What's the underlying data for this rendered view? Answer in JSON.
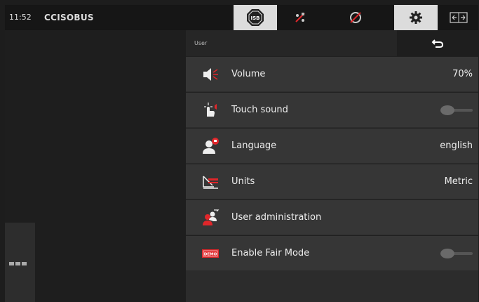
{
  "status": {
    "time": "11:52",
    "brand": "CCISOBUS"
  },
  "topbar": {
    "isb_label": "ISB",
    "buttons": [
      "isb-icon",
      "task-controller-icon",
      "speed-off-icon",
      "gear-icon",
      "switch-screen-icon"
    ]
  },
  "header": {
    "title": "User"
  },
  "settings": [
    {
      "label": "Volume",
      "value": "70%",
      "icon": "volume-icon"
    },
    {
      "label": "Touch sound",
      "value": "",
      "icon": "touch-sound-icon",
      "toggle": false
    },
    {
      "label": "Language",
      "value": "english",
      "icon": "language-icon"
    },
    {
      "label": "Units",
      "value": "Metric",
      "icon": "units-icon"
    },
    {
      "label": "User administration",
      "value": "",
      "icon": "user-admin-icon"
    },
    {
      "label": "Enable Fair Mode",
      "value": "",
      "icon": "demo-icon",
      "toggle": false,
      "icon_text": "DEMO"
    }
  ],
  "colors": {
    "accent_red": "#e0262a",
    "panel": "#363636",
    "active_tab": "#dcdcdc"
  }
}
